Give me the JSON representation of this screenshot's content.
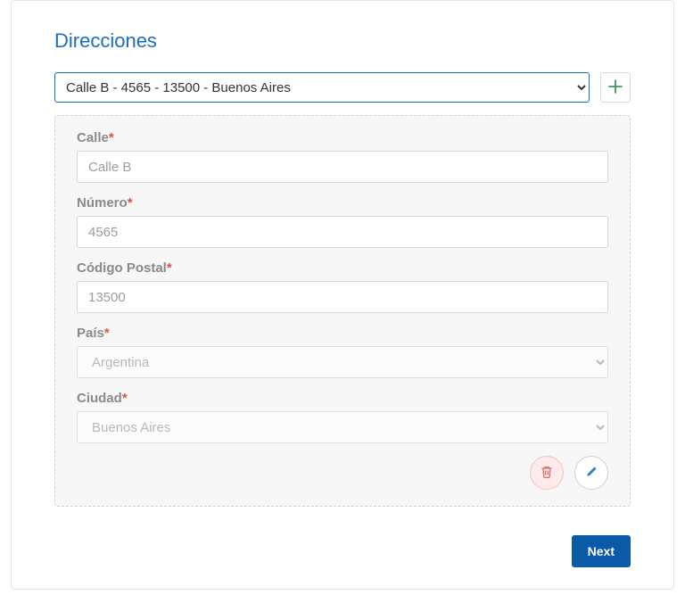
{
  "section_title": "Direcciones",
  "address_select": {
    "selected": "Calle B - 4565 - 13500 - Buenos Aires"
  },
  "fields": {
    "calle": {
      "label": "Calle",
      "value": "Calle B"
    },
    "numero": {
      "label": "Número",
      "value": "4565"
    },
    "codigo_postal": {
      "label": "Código Postal",
      "value": "13500"
    },
    "pais": {
      "label": "País",
      "value": "Argentina"
    },
    "ciudad": {
      "label": "Ciudad",
      "value": "Buenos Aires"
    }
  },
  "required_mark": "*",
  "next_label": "Next",
  "colors": {
    "accent": "#1a6ebf",
    "danger": "#d9534f",
    "primary_btn": "#0b5aa8"
  }
}
